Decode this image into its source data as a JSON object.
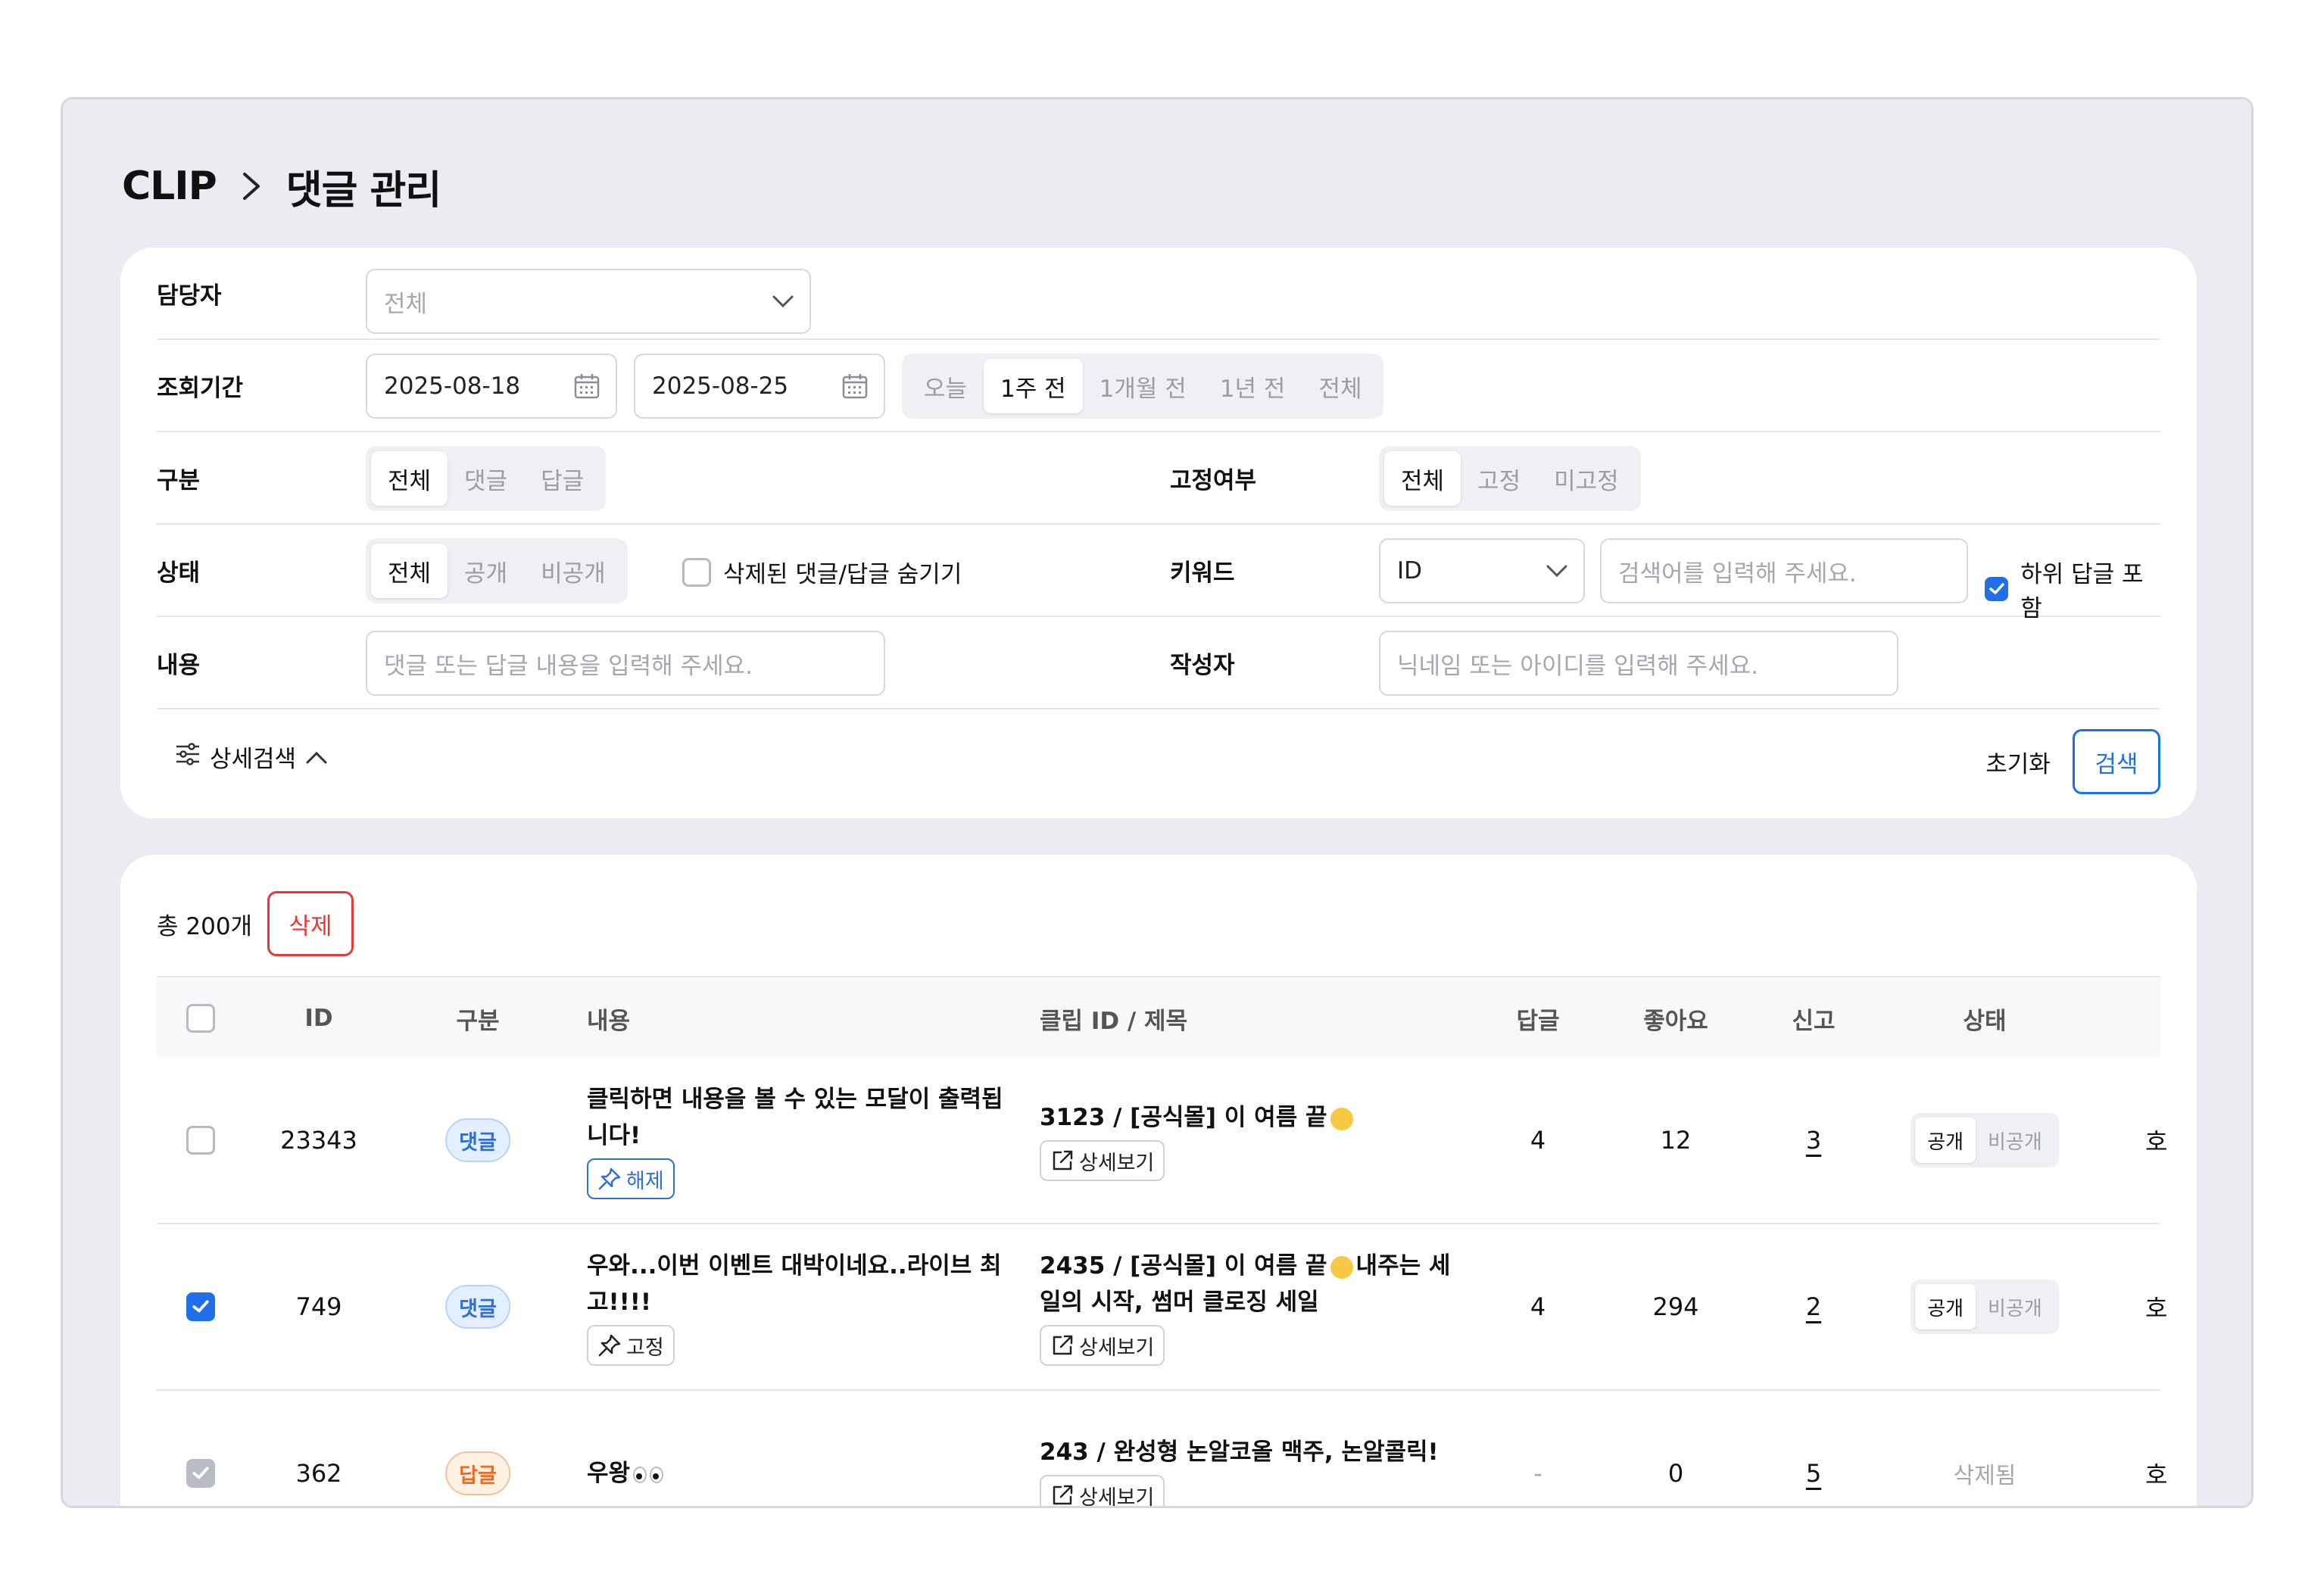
{
  "breadcrumb": {
    "root": "CLIP",
    "current": "댓글 관리"
  },
  "filters": {
    "manager": {
      "label": "담당자",
      "value": "전체"
    },
    "period": {
      "label": "조회기간",
      "start": "2025-08-18",
      "end": "2025-08-25",
      "presets": [
        "오늘",
        "1주 전",
        "1개월 전",
        "1년 전",
        "전체"
      ],
      "selected_preset": "1주 전"
    },
    "category": {
      "label": "구분",
      "options": [
        "전체",
        "댓글",
        "답글"
      ],
      "selected": "전체"
    },
    "pinned": {
      "label": "고정여부",
      "options": [
        "전체",
        "고정",
        "미고정"
      ],
      "selected": "전체"
    },
    "status": {
      "label": "상태",
      "options": [
        "전체",
        "공개",
        "비공개"
      ],
      "selected": "전체",
      "hide_deleted_label": "삭제된 댓글/답글 숨기기",
      "hide_deleted_checked": false
    },
    "keyword": {
      "label": "키워드",
      "type_value": "ID",
      "placeholder": "검색어를 입력해 주세요.",
      "include_replies_label": "하위 답글 포함",
      "include_replies_checked": true
    },
    "content": {
      "label": "내용",
      "placeholder": "댓글 또는 답글 내용을 입력해 주세요."
    },
    "author": {
      "label": "작성자",
      "placeholder": "닉네임 또는 아이디를 입력해 주세요."
    },
    "advanced_label": "상세검색",
    "reset_label": "초기화",
    "search_label": "검색"
  },
  "list": {
    "total_label": "총 200개",
    "delete_label": "삭제",
    "columns": [
      "ID",
      "구분",
      "내용",
      "클립 ID / 제목",
      "답글",
      "좋아요",
      "신고",
      "상태"
    ],
    "rows": [
      {
        "checked": false,
        "id": "23343",
        "type": "댓글",
        "type_color": "blue",
        "content": "클릭하면 내용을 볼 수 있는 모달이 출력됩니다!",
        "pin_label": "해제",
        "pin_active": true,
        "clip_title": "3123 / [공식몰] 이 여름 끝",
        "clip_title_tail": "",
        "detail_label": "상세보기",
        "replies": "4",
        "likes": "12",
        "reports": "3",
        "status_options": [
          "공개",
          "비공개"
        ],
        "status_selected": "공개",
        "extra": "호"
      },
      {
        "checked": true,
        "id": "749",
        "type": "댓글",
        "type_color": "blue",
        "content": "우와...이번 이벤트 대박이네요..라이브 최고!!!!",
        "pin_label": "고정",
        "pin_active": false,
        "clip_title": "2435 / [공식몰] 이 여름 끝",
        "clip_title_tail": "내주는 세일의 시작, 썸머 클로징 세일",
        "detail_label": "상세보기",
        "replies": "4",
        "likes": "294",
        "reports": "2",
        "status_options": [
          "공개",
          "비공개"
        ],
        "status_selected": "공개",
        "extra": "호"
      },
      {
        "checked": true,
        "disabled": true,
        "id": "362",
        "type": "답글",
        "type_color": "orange",
        "content": "우왕",
        "clip_title": "243 / 완성형 논알코올 맥주, 논알콜릭!",
        "detail_label": "상세보기",
        "replies": "-",
        "likes": "0",
        "reports": "5",
        "status_text": "삭제됨",
        "extra": "호"
      }
    ]
  },
  "colors": {
    "accent": "#1e6fe8",
    "danger": "#e53935",
    "frame_bg": "#ebecf1",
    "reply_orange": "#ee6a21"
  }
}
